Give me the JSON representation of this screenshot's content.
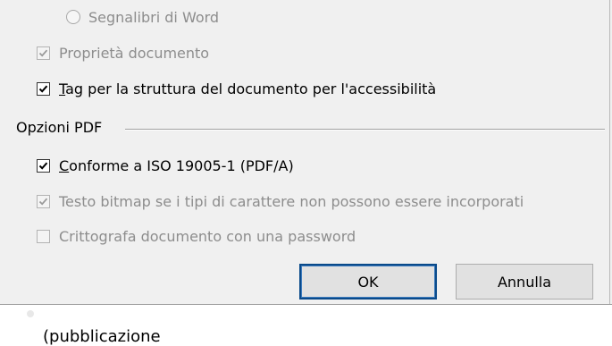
{
  "dialog": {
    "radio_word_bookmarks": {
      "label": "Segnalibri di Word",
      "enabled": false,
      "selected": false
    },
    "checkbox_document_properties": {
      "label": "Proprietà documento",
      "checked": true,
      "enabled": false
    },
    "checkbox_structure_tags": {
      "label": "Tag per la struttura del documento per l'accessibilità",
      "checked": true,
      "enabled": true
    },
    "pdf_options": {
      "group_label": "Opzioni PDF",
      "iso_compliant": {
        "label": "Conforme a ISO 19005-1 (PDF/A)",
        "checked": true,
        "enabled": true
      },
      "bitmap_text": {
        "label": "Testo bitmap se i tipi di carattere non possono essere incorporati",
        "checked": true,
        "enabled": false
      },
      "encrypt_document": {
        "label": "Crittografa documento con una password",
        "checked": false,
        "enabled": false
      }
    },
    "buttons": {
      "ok_label": "OK",
      "cancel_label": "Annulla"
    }
  },
  "background": {
    "partial_text": "(pubblicazione"
  },
  "colors": {
    "dialog_bg": "#f0f0f0",
    "disabled_text": "#8d8d8d",
    "default_button_border": "#0a4a8a"
  }
}
